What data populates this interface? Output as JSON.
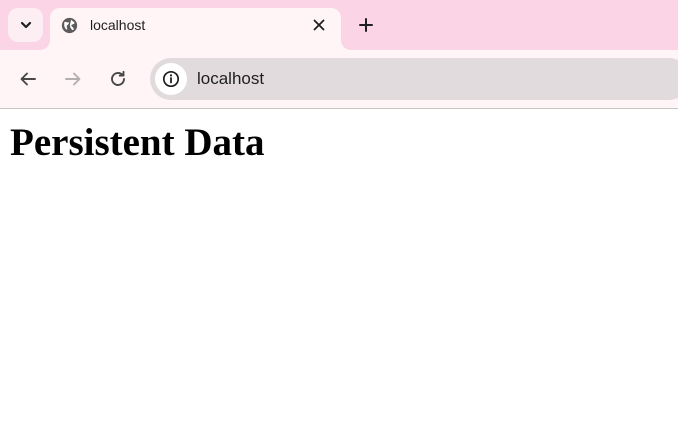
{
  "tabs": [
    {
      "title": "localhost",
      "favicon": "globe-icon",
      "close_icon": "close-icon",
      "active": true
    }
  ],
  "tabstrip": {
    "tab_search_icon": "chevron-down-icon",
    "new_tab_icon": "plus-icon"
  },
  "toolbar": {
    "back_icon": "arrow-left-icon",
    "forward_icon": "arrow-right-icon",
    "reload_icon": "reload-icon",
    "site_info_icon": "info-icon",
    "url": "localhost"
  },
  "page": {
    "heading": "Persistent Data"
  },
  "colors": {
    "tabstrip_bg": "#fbd5e6",
    "toolbar_bg": "#fff5f7",
    "omnibox_bg": "#e1dbdd",
    "page_bg": "#ffffff"
  }
}
